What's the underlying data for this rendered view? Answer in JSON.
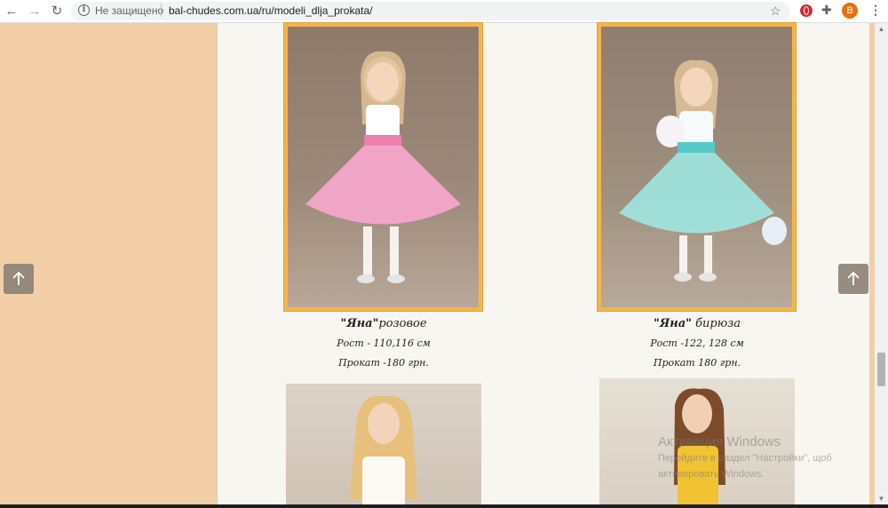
{
  "browser": {
    "security_label": "Не защищено",
    "url": "bal-chudes.com.ua/ru/modeli_dlja_prokata/",
    "profile_initial": "B",
    "icons": [
      "back-arrow-icon",
      "forward-arrow-icon",
      "reload-icon",
      "info-icon",
      "star-icon",
      "opera-extension-icon",
      "puzzle-icon",
      "menu-dots-icon"
    ]
  },
  "products": [
    {
      "name": "\"Яна\"",
      "color_suffix": "розовое",
      "height": "Рост - 110,116 см",
      "price": "Прокат -180 грн.",
      "dress_color": "#f4a6cb",
      "sash_color": "#ef7fb0"
    },
    {
      "name": "\"Яна\"",
      "color_suffix": " бирюза",
      "height": "Рост -122, 128 см",
      "price": "Прокат 180 грн.",
      "dress_color": "#9fe3dc",
      "sash_color": "#56c7c9"
    }
  ],
  "colors": {
    "page_background": "#f3cfa8",
    "content_background": "#f7f6f1",
    "frame_gold": "#f2b64a",
    "scroll_button": "#8e8478"
  },
  "watermark": {
    "title": "Активация Windows",
    "line1": "Перейдите в раздел \"Настройки\", щоб",
    "line2": "активировать Windows."
  }
}
